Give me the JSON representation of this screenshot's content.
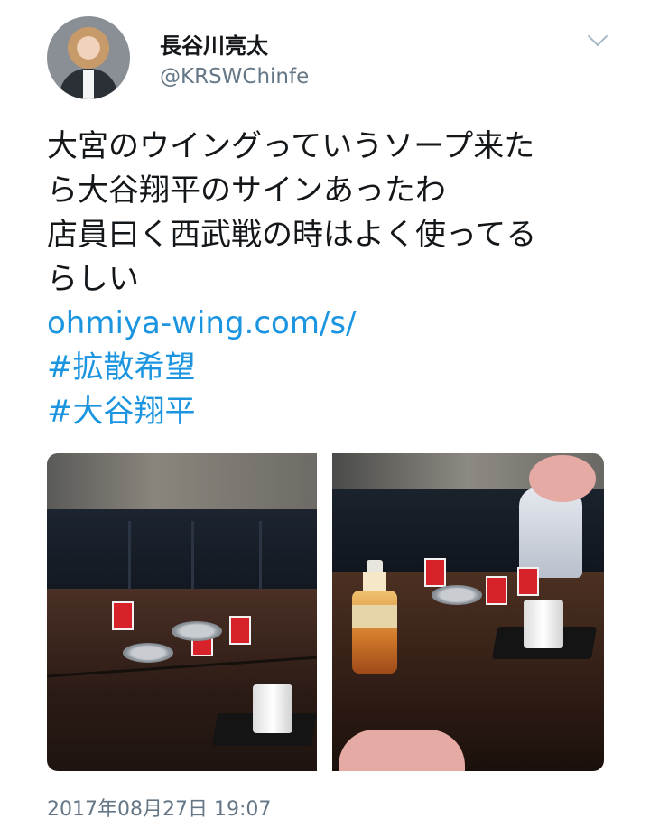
{
  "tweet": {
    "author_name": "長谷川亮太",
    "handle": "@KRSWChinfe",
    "lines": [
      "大宮のウイングっていうソープ来た",
      "ら大谷翔平のサインあったわ",
      "店員曰く西武戦の時はよく使ってる",
      "らしい"
    ],
    "link": "ohmiya-wing.com/s/",
    "hashtags": [
      "#拡散希望",
      "#大谷翔平"
    ],
    "timestamp": "2017年08月27日 19:07"
  },
  "icons": {
    "menu": "chevron-down-icon"
  },
  "colors": {
    "link": "#1b95e0",
    "secondary_text": "#657786"
  }
}
